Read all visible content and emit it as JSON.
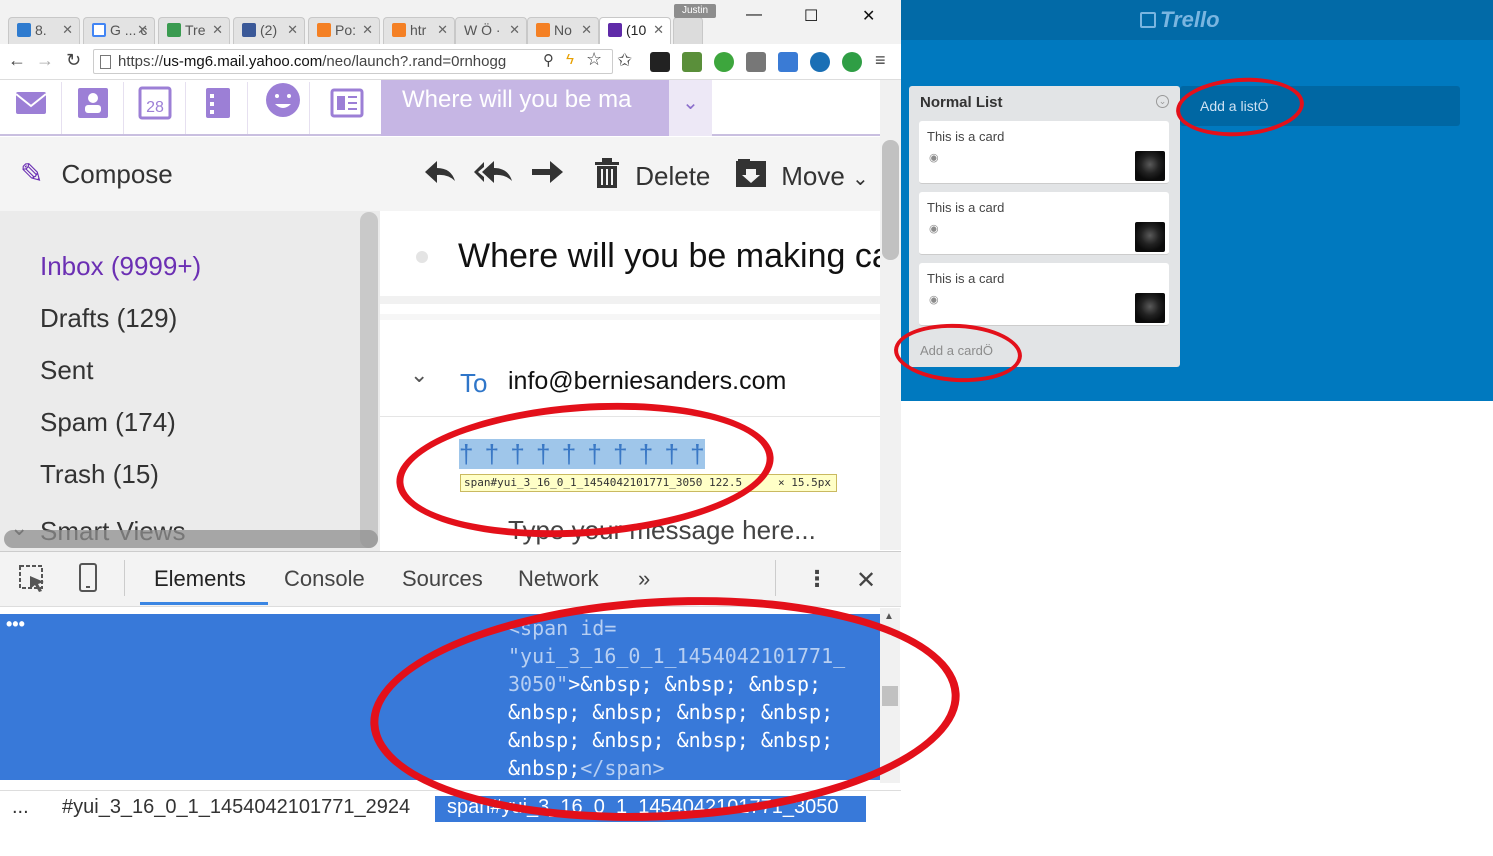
{
  "browser": {
    "tabs": [
      {
        "label": "8. ",
        "icon": "trello-favicon-icon"
      },
      {
        "label": "G ... c",
        "icon": "google-favicon-icon"
      },
      {
        "label": "Tre",
        "icon": "sheet-favicon-icon"
      },
      {
        "label": "(2)",
        "icon": "facebook-favicon-icon"
      },
      {
        "label": "Po:",
        "icon": "stack-favicon-icon"
      },
      {
        "label": "htr",
        "icon": "stack-favicon-icon"
      },
      {
        "label": "W Ö ·",
        "icon": "wikipedia-favicon-icon"
      },
      {
        "label": "No",
        "icon": "stack-favicon-icon"
      },
      {
        "label": "(10",
        "icon": "yahoo-mail-favicon-icon"
      }
    ],
    "user_badge": "Justin",
    "url_prefix": "https://",
    "url_host": "us-mg6.mail.yahoo.com",
    "url_rest": "/neo/launch?.rand=0rnhogg"
  },
  "yahoo": {
    "search_text": "Where will you be ma",
    "compose_label": "Compose",
    "delete_label": "Delete",
    "move_label": "Move",
    "folders": {
      "inbox": "Inbox (9999+)",
      "drafts": "Drafts (129)",
      "sent": "Sent",
      "spam": "Spam (174)",
      "trash": "Trash (15)",
      "smart_views": "Smart Views"
    },
    "subject": "Where will you be making ca",
    "to_label": "To",
    "to_address": "info@berniesanders.com",
    "selected_text": "† † † † † † † † † † † †",
    "inspect_tooltip": "span#yui_3_16_0_1_1454042101771_3050  122.5",
    "inspect_size": "× 15.5px",
    "body_placeholder": "Type your message here..."
  },
  "devtools": {
    "tabs": [
      "Elements",
      "Console",
      "Sources",
      "Network"
    ],
    "more_tabs": "»",
    "code_tag_open": "<span id=",
    "code_id_line1": "\"yui_3_16_0_1_1454042101771_",
    "code_id_line2": "3050\"",
    "code_line3": ">&nbsp; &nbsp; &nbsp;",
    "code_line4": "&nbsp; &nbsp; &nbsp; &nbsp;",
    "code_line5": "&nbsp; &nbsp; &nbsp; &nbsp;",
    "code_line6_a": "&nbsp;",
    "code_line6_b": "</span>",
    "breadcrumb_dots": "...",
    "breadcrumb_path": "#yui_3_16_0_1_1454042101771_2924",
    "breadcrumb_selected": "span#yui_3_16_0_1_1454042101771_3050"
  },
  "trello": {
    "logo": "Trello",
    "list_name": "Normal List",
    "cards": [
      "This is a card",
      "This is a card",
      "This is a card"
    ],
    "add_card": "Add a cardÖ",
    "add_list": "Add a listÖ"
  },
  "colors": {
    "annotation_red": "#e3101a",
    "trello_blue": "#0079bf",
    "yahoo_purple": "#6b2fb3",
    "devtools_selection": "#3879d9"
  }
}
